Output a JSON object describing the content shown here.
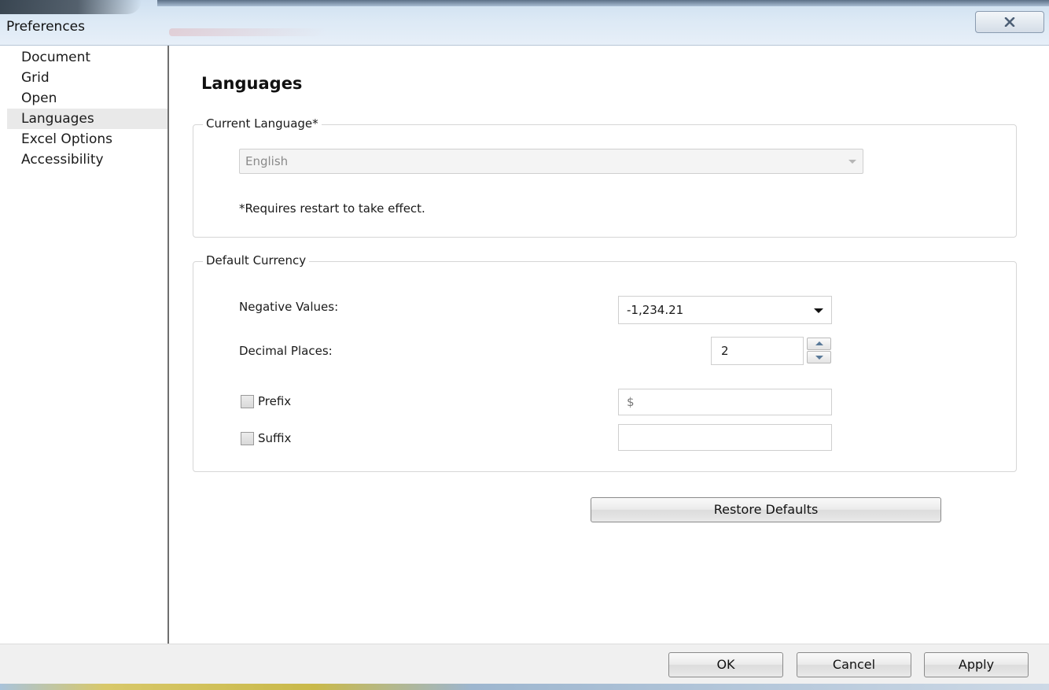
{
  "window": {
    "title": "Preferences",
    "close_icon": "close-icon"
  },
  "sidebar": {
    "items": [
      {
        "label": "Document",
        "selected": false
      },
      {
        "label": "Grid",
        "selected": false
      },
      {
        "label": "Open",
        "selected": false
      },
      {
        "label": "Languages",
        "selected": true
      },
      {
        "label": "Excel Options",
        "selected": false
      },
      {
        "label": "Accessibility",
        "selected": false
      }
    ]
  },
  "main": {
    "heading": "Languages",
    "current_language": {
      "legend": "Current Language*",
      "value": "English",
      "disabled": true,
      "note": "*Requires restart to take effect."
    },
    "default_currency": {
      "legend": "Default Currency",
      "negative_values_label": "Negative Values:",
      "negative_values_value": "-1,234.21",
      "decimal_places_label": "Decimal Places:",
      "decimal_places_value": "2",
      "prefix_label": "Prefix",
      "prefix_checked": false,
      "prefix_value": "$",
      "suffix_label": "Suffix",
      "suffix_checked": false,
      "suffix_value": ""
    },
    "restore_defaults_label": "Restore Defaults"
  },
  "footer": {
    "ok_label": "OK",
    "cancel_label": "Cancel",
    "apply_label": "Apply"
  },
  "colors": {
    "titlebar": "#dce9f5",
    "selected_item": "#e9e9e9",
    "footer": "#f0f0f0"
  }
}
